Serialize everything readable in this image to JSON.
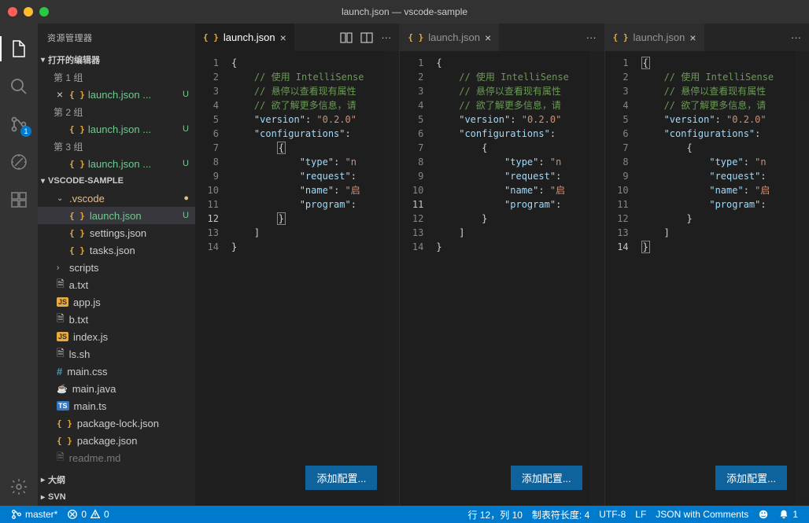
{
  "title": "launch.json — vscode-sample",
  "sidebar": {
    "title": "资源管理器",
    "open_editors_header": "打开的编辑器",
    "groups": [
      {
        "label": "第 1 组",
        "file": "launch.json ...",
        "vcs": "U",
        "close": true
      },
      {
        "label": "第 2 组",
        "file": "launch.json ...",
        "vcs": "U",
        "close": false
      },
      {
        "label": "第 3 组",
        "file": "launch.json ...",
        "vcs": "U",
        "close": false
      }
    ],
    "workspace_header": "VSCODE-SAMPLE",
    "vscode_folder": ".vscode",
    "vscode_files": [
      {
        "name": "launch.json",
        "vcs": "U",
        "selected": true,
        "icon": "json"
      },
      {
        "name": "settings.json",
        "vcs": "",
        "icon": "json"
      },
      {
        "name": "tasks.json",
        "vcs": "",
        "icon": "json"
      }
    ],
    "scripts_folder": "scripts",
    "root_files": [
      {
        "name": "a.txt",
        "icon": "file"
      },
      {
        "name": "app.js",
        "icon": "js"
      },
      {
        "name": "b.txt",
        "icon": "file"
      },
      {
        "name": "index.js",
        "icon": "js"
      },
      {
        "name": "ls.sh",
        "icon": "file"
      },
      {
        "name": "main.css",
        "icon": "hash"
      },
      {
        "name": "main.java",
        "icon": "java"
      },
      {
        "name": "main.ts",
        "icon": "ts"
      },
      {
        "name": "package-lock.json",
        "icon": "json"
      },
      {
        "name": "package.json",
        "icon": "json"
      },
      {
        "name": "readme.md",
        "icon": "file"
      }
    ],
    "outline": "大纲",
    "svn": "SVN"
  },
  "editor": {
    "tab_label": "launch.json",
    "add_config": "添加配置...",
    "code": {
      "l2": "// 使用 IntelliSense",
      "l3": "// 悬停以查看现有属性",
      "l4": "// 欲了解更多信息，请",
      "l5_key": "\"version\"",
      "l5_val": "\"0.2.0\"",
      "l6_key": "\"configurations\"",
      "l8_key": "\"type\"",
      "l8_val": "\"n",
      "l9_key": "\"request\"",
      "l10_key": "\"name\"",
      "l10_val": "\"启",
      "l11_key": "\"program\""
    }
  },
  "status": {
    "branch": "master*",
    "errors": "0",
    "warnings": "0",
    "cursor": "行 12，列 10",
    "tabsize": "制表符长度: 4",
    "encoding": "UTF-8",
    "eol": "LF",
    "language": "JSON with Comments",
    "bell_count": "1"
  },
  "scm_badge": "1"
}
